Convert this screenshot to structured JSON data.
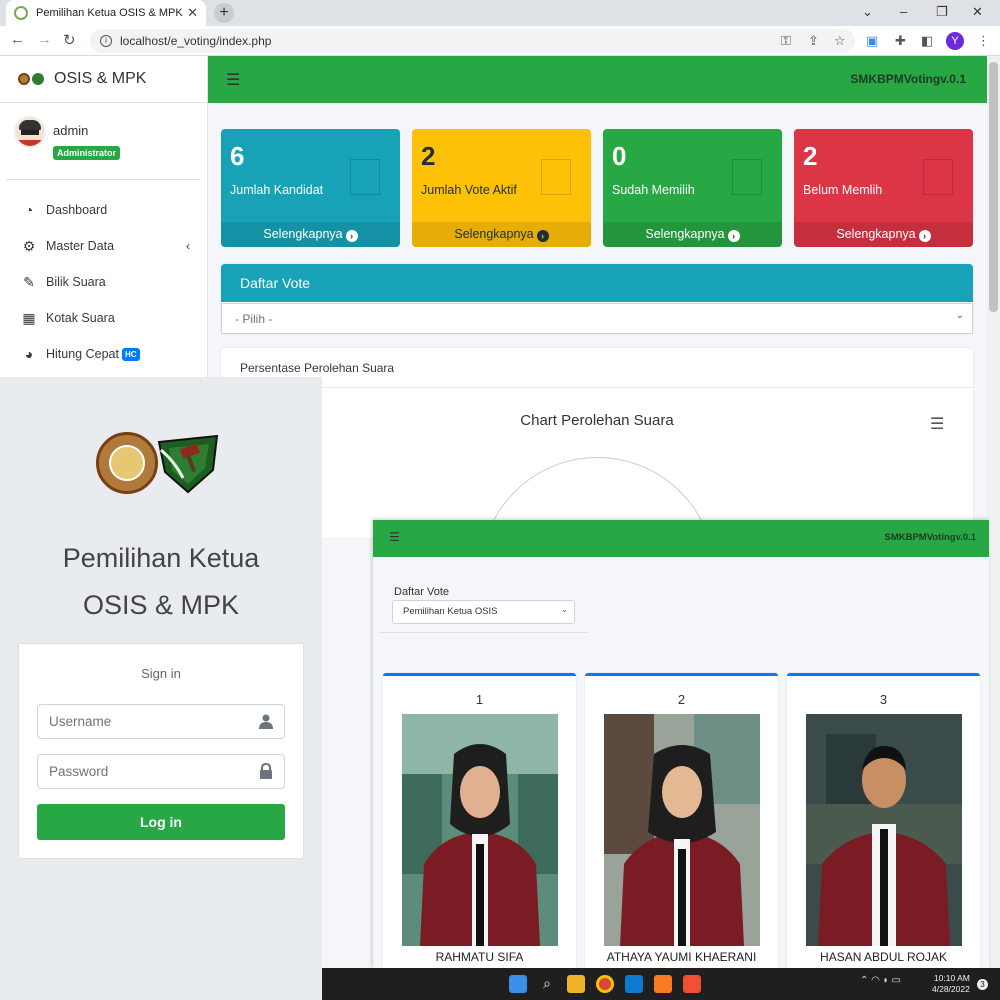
{
  "browser": {
    "tab_title": "Pemilihan Ketua OSIS & MPK",
    "tab_close": "✕",
    "new_tab": "+",
    "url": "localhost/e_voting/index.php",
    "profile_initial": "Y"
  },
  "sidebar": {
    "brand": "OSIS & MPK",
    "user_name": "admin",
    "user_role": "Administrator",
    "items": [
      {
        "label": "Dashboard",
        "icon": "tachometer-icon"
      },
      {
        "label": "Master Data",
        "icon": "cogs-icon",
        "arrow": "‹"
      },
      {
        "label": "Bilik Suara",
        "icon": "edit-icon"
      },
      {
        "label": "Kotak Suara",
        "icon": "table-icon"
      },
      {
        "label": "Hitung Cepat",
        "icon": "pie-chart-icon",
        "badge": "HC"
      }
    ]
  },
  "topnav": {
    "version": "SMKBPMVotingv.0.1"
  },
  "stats": [
    {
      "value": "6",
      "label": "Jumlah Kandidat",
      "link": "Selengkapnya",
      "color": "#17a2b8"
    },
    {
      "value": "2",
      "label": "Jumlah Vote Aktif",
      "link": "Selengkapnya",
      "color": "#ffc107"
    },
    {
      "value": "0",
      "label": "Sudah Memilih",
      "link": "Selengkapnya",
      "color": "#28a745"
    },
    {
      "value": "2",
      "label": "Belum Memlih",
      "link": "Selengkapnya",
      "color": "#dc3545"
    }
  ],
  "vote_card": {
    "title": "Daftar Vote",
    "select_value": "- Pilih -"
  },
  "chart_card": {
    "header": "Persentase Perolehan Suara",
    "chart_title": "Chart Perolehan Suara"
  },
  "login": {
    "title_line1": "Pemilihan Ketua",
    "title_line2": "OSIS & MPK",
    "signin": "Sign in",
    "username_placeholder": "Username",
    "password_placeholder": "Password",
    "button": "Log in"
  },
  "candidates_view": {
    "version": "SMKBPMVotingv.0.1",
    "vote_label": "Daftar Vote",
    "vote_selected": "Pemilihan Ketua OSIS",
    "candidates": [
      {
        "number": "1",
        "name": "RAHMATU SIFA"
      },
      {
        "number": "2",
        "name": "ATHAYA YAUMI KHAERANI"
      },
      {
        "number": "3",
        "name": "HASAN ABDUL ROJAK"
      }
    ]
  },
  "taskbar": {
    "time": "10:10 AM",
    "date": "4/28/2022",
    "notifications": "3"
  }
}
